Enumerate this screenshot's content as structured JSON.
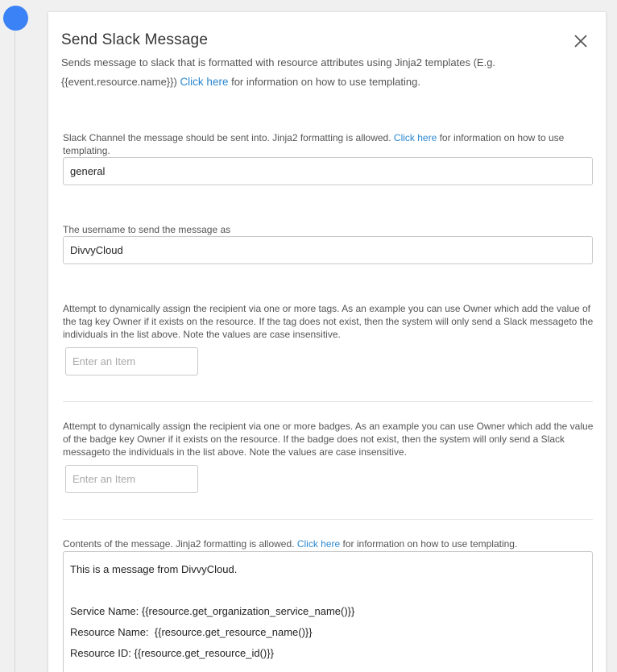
{
  "modal": {
    "title": "Send Slack Message",
    "subtitle": {
      "text_before": "Sends message to slack that is formatted with resource attributes using Jinja2 templates (E.g. {{event.resource.name}}) ",
      "link": "Click here",
      "text_after": " for information on how to use templating."
    }
  },
  "channel": {
    "label_before": "Slack Channel the message should be sent into. Jinja2 formatting is allowed. ",
    "link": "Click here",
    "label_after": " for information on how to use templating.",
    "value": "general"
  },
  "username": {
    "label": "The username to send the message as",
    "value": "DivvyCloud"
  },
  "tags": {
    "label": "Attempt to dynamically assign the recipient via one or more tags. As an example you can use Owner which add the value of the tag key Owner if it exists on the resource. If the tag does not exist, then the system will only send a Slack messageto the individuals in the list above. Note the values are case insensitive.",
    "placeholder": "Enter an Item"
  },
  "badges": {
    "label": "Attempt to dynamically assign the recipient via one or more badges. As an example you can use Owner which add the value of the badge key Owner if it exists on the resource. If the badge does not exist, then the system will only send a Slack messageto the individuals in the list above. Note the values are case insensitive.",
    "placeholder": "Enter an Item"
  },
  "message": {
    "label_before": "Contents of the message. Jinja2 formatting is allowed. ",
    "link": "Click here",
    "label_after": " for information on how to use templating.",
    "lines": [
      "This is a message from DivvyCloud.",
      "",
      "Service Name: {{resource.get_organization_service_name()}}",
      "Resource Name:  {{resource.get_resource_name()}}",
      "Resource ID: {{resource.get_resource_id()}}"
    ]
  },
  "colors": {
    "accent": "#3b82f6",
    "link": "#2a87d0"
  }
}
